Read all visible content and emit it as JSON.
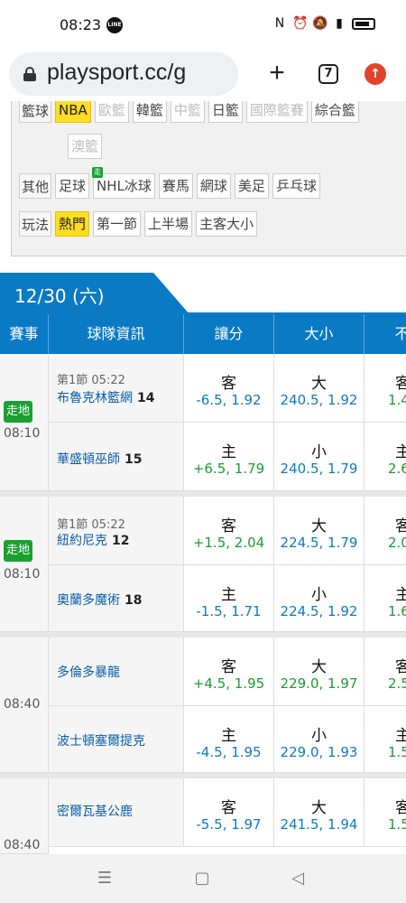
{
  "status_bar": {
    "time": "08:23",
    "line_app": "LINE",
    "battery_icon": "battery-icon"
  },
  "browser": {
    "url": "playsport.cc/g",
    "tab_count": "7",
    "new_tab": "+",
    "update": "↑"
  },
  "filters": [
    {
      "label": "籃球",
      "chips": [
        {
          "text": "NBA",
          "state": "active"
        },
        {
          "text": "歐籃",
          "state": "dim"
        },
        {
          "text": "韓籃",
          "state": "normal"
        },
        {
          "text": "中籃",
          "state": "dim"
        },
        {
          "text": "日籃",
          "state": "normal"
        },
        {
          "text": "國際籃賽",
          "state": "dim"
        },
        {
          "text": "綜合籃",
          "state": "normal"
        }
      ]
    },
    {
      "label": "",
      "chips": [
        {
          "text": "澳籃",
          "state": "dim"
        }
      ]
    },
    {
      "label": "其他",
      "chips": [
        {
          "text": "足球",
          "state": "normal"
        },
        {
          "text": "NHL冰球",
          "state": "normal",
          "badge": "走"
        },
        {
          "text": "賽馬",
          "state": "normal"
        },
        {
          "text": "網球",
          "state": "normal"
        },
        {
          "text": "美足",
          "state": "normal"
        },
        {
          "text": "乒乓球",
          "state": "normal"
        }
      ]
    },
    {
      "label": "玩法",
      "chips": [
        {
          "text": "熱門",
          "state": "active"
        },
        {
          "text": "第一節",
          "state": "normal"
        },
        {
          "text": "上半場",
          "state": "normal"
        },
        {
          "text": "主客大小",
          "state": "normal"
        }
      ]
    }
  ],
  "date_tab": "12/30 (六)",
  "table_headers": {
    "event": "賽事",
    "team": "球隊資訊",
    "handicap": "讓分",
    "total": "大小",
    "moneyline": "不讓"
  },
  "matches": [
    {
      "live": "走地",
      "time": "08:10",
      "period": "第1節 05:22",
      "away": {
        "name": "布魯克林籃網",
        "score": "14",
        "hcap_side": "客",
        "hcap": "-6.5, 1.92",
        "ou_side": "大",
        "ou": "240.5, 1.92",
        "ml_side": "客",
        "ml": "1.4"
      },
      "home": {
        "name": "華盛頓巫師",
        "score": "15",
        "hcap_side": "主",
        "hcap": "+6.5, 1.79",
        "ou_side": "小",
        "ou": "240.5, 1.79",
        "ml_side": "主",
        "ml": "2.6"
      }
    },
    {
      "live": "走地",
      "time": "08:10",
      "period": "第1節 05:22",
      "away": {
        "name": "紐約尼克",
        "score": "12",
        "hcap_side": "客",
        "hcap": "+1.5, 2.04",
        "ou_side": "大",
        "ou": "224.5, 1.79",
        "ml_side": "客",
        "ml": "2.0"
      },
      "home": {
        "name": "奧蘭多魔術",
        "score": "18",
        "hcap_side": "主",
        "hcap": "-1.5, 1.71",
        "ou_side": "小",
        "ou": "224.5, 1.92",
        "ml_side": "主",
        "ml": "1.6"
      }
    },
    {
      "live": "",
      "time": "08:40",
      "period": "",
      "away": {
        "name": "多倫多暴龍",
        "score": "",
        "hcap_side": "客",
        "hcap": "+4.5, 1.95",
        "ou_side": "大",
        "ou": "229.0, 1.97",
        "ml_side": "客",
        "ml": "2.5"
      },
      "home": {
        "name": "波士頓塞爾提克",
        "score": "",
        "hcap_side": "主",
        "hcap": "-4.5, 1.95",
        "ou_side": "小",
        "ou": "229.0, 1.93",
        "ml_side": "主",
        "ml": "1.5"
      }
    },
    {
      "live": "",
      "time": "08:40",
      "period": "",
      "away": {
        "name": "密爾瓦基公鹿",
        "score": "",
        "hcap_side": "客",
        "hcap": "-5.5, 1.97",
        "ou_side": "大",
        "ou": "241.5, 1.94",
        "ml_side": "客",
        "ml": "1.5"
      },
      "home": {
        "name": "",
        "score": "",
        "hcap_side": "",
        "hcap": "",
        "ou_side": "",
        "ou": "",
        "ml_side": "",
        "ml": ""
      }
    }
  ],
  "nav": {
    "menu": "☰",
    "home": "▢",
    "back": "◁"
  },
  "colors": {
    "primary": "#0a7ac4",
    "live": "#1aa030",
    "active_chip": "#ffdd22"
  }
}
